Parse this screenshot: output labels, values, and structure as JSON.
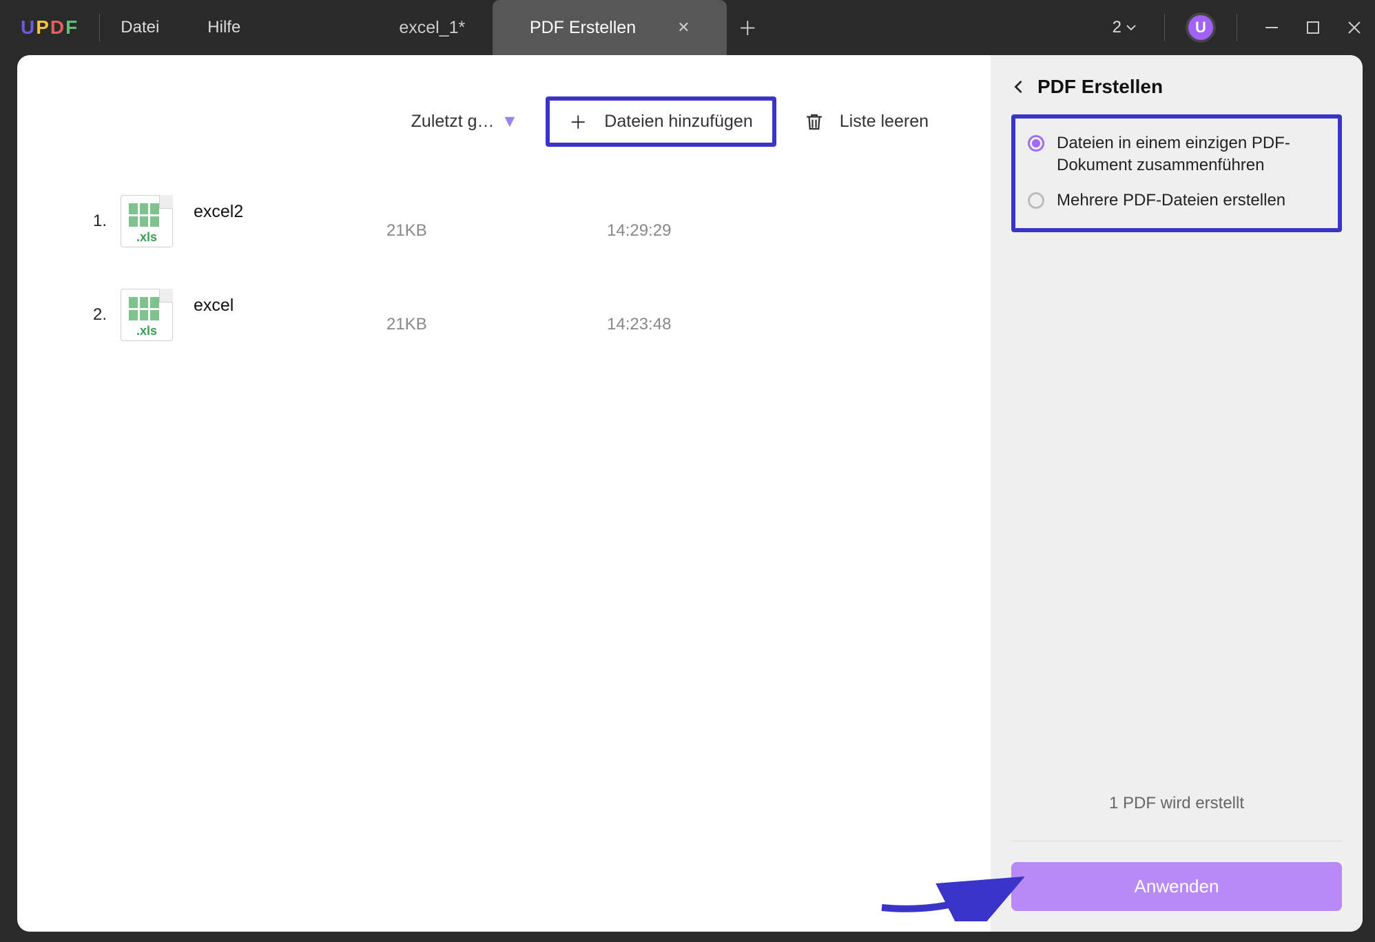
{
  "app_logo": "UPDF",
  "menu": {
    "file": "Datei",
    "help": "Hilfe"
  },
  "tabs": {
    "inactive": "excel_1*",
    "active": "PDF Erstellen"
  },
  "window": {
    "counter": "2",
    "avatar": "U"
  },
  "main": {
    "sort_label": "Zuletzt g…",
    "add_files": "Dateien hinzufügen",
    "clear_list": "Liste leeren",
    "files": [
      {
        "num": "1.",
        "name": "excel2",
        "ext": ".xls",
        "size": "21KB",
        "time": "14:29:29"
      },
      {
        "num": "2.",
        "name": "excel",
        "ext": ".xls",
        "size": "21KB",
        "time": "14:23:48"
      }
    ]
  },
  "side": {
    "title": "PDF Erstellen",
    "opt_merge": "Dateien in einem einzigen PDF-Dokument zusammenführen",
    "opt_multi": "Mehrere PDF-Dateien erstellen",
    "status": "1 PDF wird erstellt",
    "apply": "Anwenden"
  }
}
